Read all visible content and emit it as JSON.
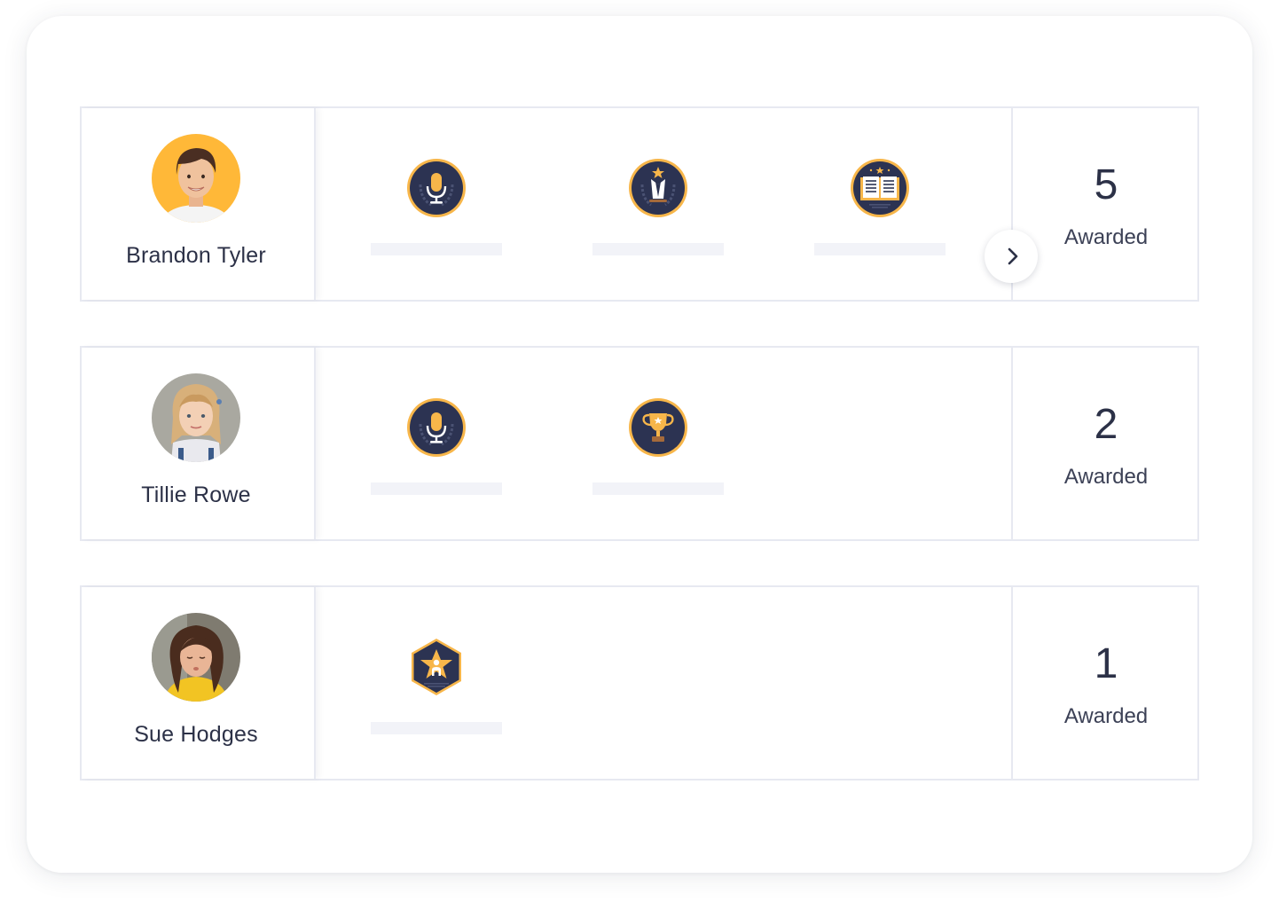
{
  "students": [
    {
      "name": "Brandon Tyler",
      "avatar_icon": "boy-avatar",
      "avatar_bg": "#ffb838",
      "badges": [
        "microphone-badge-icon",
        "tuxedo-star-badge-icon",
        "open-book-badge-icon"
      ],
      "awarded_count": "5",
      "awarded_label": "Awarded",
      "has_next": true
    },
    {
      "name": "Tillie Rowe",
      "avatar_icon": "girl-blonde-avatar",
      "avatar_bg": "#a9a8a0",
      "badges": [
        "microphone-badge-icon",
        "trophy-badge-icon"
      ],
      "awarded_count": "2",
      "awarded_label": "Awarded",
      "has_next": false
    },
    {
      "name": "Sue Hodges",
      "avatar_icon": "girl-brunette-avatar",
      "avatar_bg": "#7f7b70",
      "badges": [
        "star-person-hexagon-badge-icon"
      ],
      "awarded_count": "1",
      "awarded_label": "Awarded",
      "has_next": false
    }
  ],
  "colors": {
    "badge_navy": "#2c3352",
    "badge_gold": "#f7b64a",
    "border": "#e7e9f1",
    "placeholder": "#f2f3f8",
    "text": "#2c3147"
  }
}
